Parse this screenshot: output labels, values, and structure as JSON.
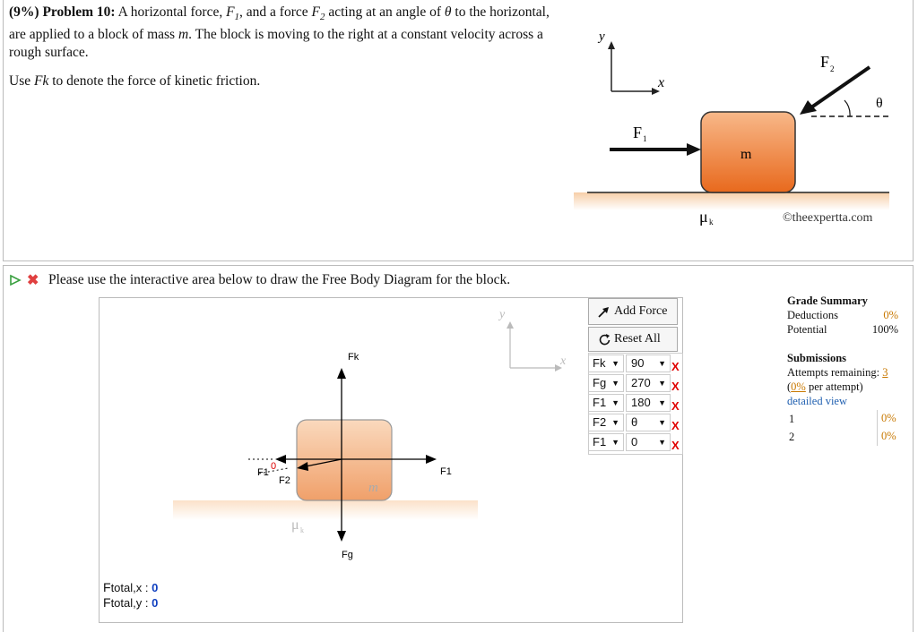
{
  "problem": {
    "prefix": "(9%) Problem 10:",
    "text_a": "A horizontal force, ",
    "f1_sym": "F",
    "f1_sub": "1",
    "text_b": ", and a force ",
    "f2_sym": "F",
    "f2_sub": "2",
    "text_c": " acting at an angle of ",
    "theta": "θ",
    "text_d": " to the horizontal, are applied to a block of mass ",
    "mass_sym": "m",
    "text_e": ". The block is moving to the right at a constant velocity across a rough surface.",
    "hint_a": "Use ",
    "hint_sym": "Fk",
    "hint_b": " to denote the force of kinetic friction."
  },
  "figure": {
    "y_axis": "y",
    "x_axis": "x",
    "f1_label": "F",
    "f1_sub": "1",
    "f2_label": "F",
    "f2_sub": "2",
    "theta": "θ",
    "mass": "m",
    "mu": "μ",
    "mu_sub": "k",
    "copyright": "©theexpertta.com"
  },
  "part": {
    "prompt": "Please use the interactive area below to draw the Free Body Diagram for the block."
  },
  "toolbar": {
    "add_force": "Add Force",
    "reset_all": "Reset All"
  },
  "forces": [
    {
      "name": "Fk",
      "angle": "90"
    },
    {
      "name": "Fg",
      "angle": "270"
    },
    {
      "name": "F1",
      "angle": "180"
    },
    {
      "name": "F2",
      "angle": "θ"
    },
    {
      "name": "F1",
      "angle": "0"
    }
  ],
  "caret": "▼",
  "delete": "X",
  "canvas": {
    "y_axis": "y",
    "x_axis": "x",
    "fk": "Fk",
    "fg": "Fg",
    "f1_right": "F1",
    "f1_left": "F1",
    "f2": "F2",
    "zero": "0",
    "mass": "m",
    "mu": "μ",
    "mu_sub": "k"
  },
  "totals": {
    "fx_label_f": "F",
    "fx_label": "total,x",
    "fx_value": "0",
    "fy_label_f": "F",
    "fy_label": "total,y",
    "fy_value": "0"
  },
  "grade": {
    "title": "Grade Summary",
    "deductions_label": "Deductions",
    "deductions_value": "0%",
    "potential_label": "Potential",
    "potential_value": "100%",
    "submissions_title": "Submissions",
    "attempts_label": "Attempts remaining:",
    "attempts_value": "3",
    "per_attempt_open": "(",
    "per_attempt_pct": "0%",
    "per_attempt_text": " per attempt)",
    "detailed_view": "detailed view",
    "rows": [
      {
        "n": "1",
        "pct": "0%"
      },
      {
        "n": "2",
        "pct": "0%"
      }
    ]
  },
  "colors": {
    "block_top": "#f7b27a",
    "block_bottom": "#e96f1f",
    "floor": "#fbe3c8",
    "accent_red": "#e00000",
    "link_blue": "#1f5fb0"
  }
}
